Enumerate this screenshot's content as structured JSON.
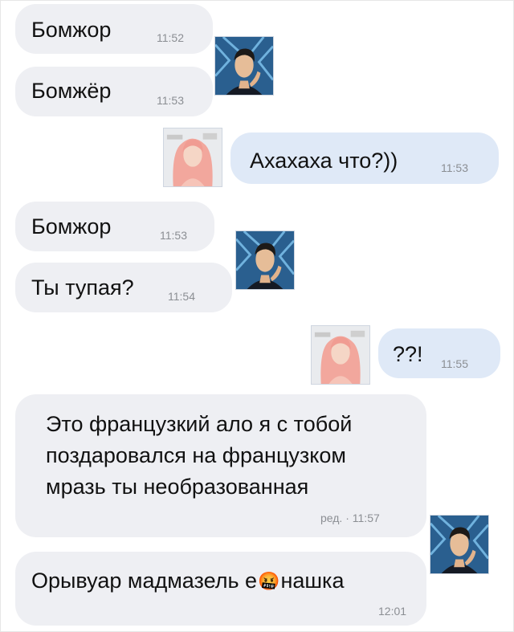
{
  "messages": [
    {
      "text": "Бомжор",
      "time": "11:52"
    },
    {
      "text": "Бомжёр",
      "time": "11:53"
    },
    {
      "text": "Ахахаха что?))",
      "time": "11:53"
    },
    {
      "text": "Бомжор",
      "time": "11:53"
    },
    {
      "text": "Ты тупая?",
      "time": "11:54"
    },
    {
      "text": "??!",
      "time": "11:55"
    },
    {
      "lines": [
        "Это французкий ало я с тобой",
        "поздаровался на французком",
        "мразь ты необразованная"
      ],
      "time": "ред. · 11:57"
    },
    {
      "text_before": "Орывуар мадмазель е",
      "emoji": "🤬",
      "text_after": "нашка",
      "time": "12:01"
    }
  ],
  "icons": {
    "male_avatar": "man-avatar-icon",
    "female_avatar": "woman-avatar-icon"
  },
  "colors": {
    "incoming_bubble": "#eeeff3",
    "outgoing_bubble": "#dfe9f7",
    "timestamp": "#8b8e93"
  }
}
